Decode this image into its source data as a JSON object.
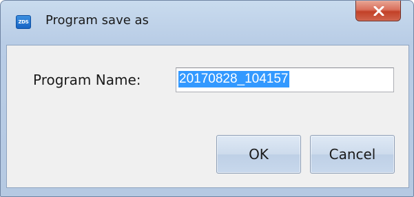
{
  "window": {
    "title": "Program save as",
    "app_icon": "app-logo-icon",
    "app_icon_text": "ZDS",
    "close_icon": "close-icon"
  },
  "form": {
    "program_name_label": "Program Name:",
    "program_name_value": "20170828_104157"
  },
  "buttons": {
    "ok_label": "OK",
    "cancel_label": "Cancel"
  },
  "colors": {
    "selection": "#3399ff",
    "close_button": "#c24128",
    "titlebar": "#c9dbee"
  }
}
